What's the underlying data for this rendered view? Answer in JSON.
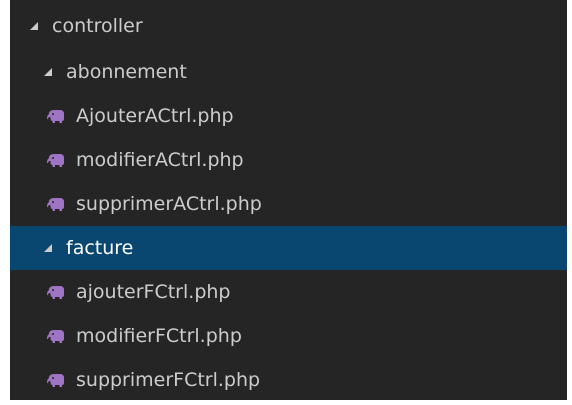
{
  "explorer": {
    "rows": [
      {
        "label": "controller",
        "type": "folder",
        "expanded": true,
        "level": 0
      },
      {
        "label": "abonnement",
        "type": "folder",
        "expanded": true,
        "level": 1
      },
      {
        "label": "AjouterACtrl.php",
        "type": "file",
        "icon": "php-icon",
        "level": 2
      },
      {
        "label": "modifierACtrl.php",
        "type": "file",
        "icon": "php-icon",
        "level": 2
      },
      {
        "label": "supprimerACtrl.php",
        "type": "file",
        "icon": "php-icon",
        "level": 2
      },
      {
        "label": "facture",
        "type": "folder",
        "expanded": true,
        "level": 1,
        "selected": true
      },
      {
        "label": "ajouterFCtrl.php",
        "type": "file",
        "icon": "php-icon",
        "level": 2
      },
      {
        "label": "modifierFCtrl.php",
        "type": "file",
        "icon": "php-icon",
        "level": 2
      },
      {
        "label": "supprimerFCtrl.php",
        "type": "file",
        "icon": "php-icon",
        "level": 2
      }
    ]
  },
  "colors": {
    "background": "#252526",
    "selection": "#094771",
    "text": "#cccccc",
    "php_icon": "#a074c4"
  }
}
